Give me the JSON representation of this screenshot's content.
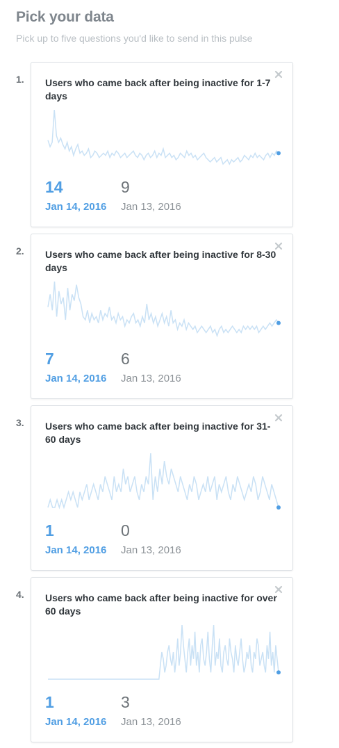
{
  "header": {
    "title": "Pick your data",
    "subtitle": "Pick up to five questions you'd like to send in this pulse"
  },
  "colors": {
    "accent": "#509ee3",
    "sparkline": "#c9e1f5"
  },
  "cards": [
    {
      "number": "1.",
      "title": "Users who came back after being inactive for 1-7 days",
      "close_icon": "close-icon",
      "current_value": "14",
      "current_date": "Jan 14, 2016",
      "previous_value": "9",
      "previous_date": "Jan 13, 2016",
      "trend": [
        14,
        11,
        13,
        28,
        16,
        13,
        15,
        12,
        10,
        13,
        9,
        11,
        7,
        10,
        12,
        8,
        9,
        7,
        8,
        10,
        6,
        7,
        9,
        8,
        6,
        7,
        8,
        7,
        9,
        6,
        8,
        7,
        9,
        8,
        6,
        7,
        8,
        6,
        7,
        8,
        9,
        7,
        6,
        8,
        7,
        5,
        7,
        8,
        6,
        7,
        9,
        6,
        8,
        7,
        10,
        6,
        7,
        8,
        6,
        7,
        5,
        6,
        8,
        7,
        6,
        9,
        7,
        8,
        6,
        7,
        5,
        6,
        7,
        8,
        6,
        5,
        4,
        5,
        6,
        4,
        5,
        6,
        3,
        4,
        5,
        3,
        5,
        4,
        5,
        6,
        4,
        5,
        7,
        6,
        5,
        7,
        6,
        8,
        6,
        7,
        6,
        5,
        7,
        8,
        6,
        8,
        7,
        9,
        8
      ]
    },
    {
      "number": "2.",
      "title": "Users who came back after being inactive for 8-30 days",
      "close_icon": "close-icon",
      "current_value": "7",
      "current_date": "Jan 14, 2016",
      "previous_value": "6",
      "previous_date": "Jan 13, 2016",
      "trend": [
        10,
        14,
        9,
        18,
        7,
        15,
        11,
        13,
        6,
        16,
        9,
        14,
        12,
        17,
        13,
        11,
        7,
        6,
        9,
        5,
        8,
        6,
        7,
        5,
        9,
        6,
        8,
        7,
        10,
        6,
        7,
        5,
        8,
        6,
        7,
        4,
        6,
        5,
        7,
        8,
        5,
        6,
        4,
        7,
        5,
        11,
        6,
        8,
        5,
        7,
        4,
        6,
        8,
        5,
        7,
        4,
        9,
        5,
        6,
        3,
        5,
        4,
        6,
        3,
        5,
        4,
        3,
        4,
        2,
        3,
        4,
        3,
        2,
        3,
        4,
        2,
        3,
        1,
        3,
        4,
        2,
        3,
        2,
        3,
        4,
        3,
        2,
        3,
        2,
        4,
        3,
        4,
        3,
        4,
        3,
        4,
        2,
        3,
        4,
        3,
        4,
        5,
        4,
        5,
        6,
        5
      ]
    },
    {
      "number": "3.",
      "title": "Users who came back after being inactive for 31-60 days",
      "close_icon": "close-icon",
      "current_value": "1",
      "current_date": "Jan 14, 2016",
      "previous_value": "0",
      "previous_date": "Jan 13, 2016",
      "trend": [
        1,
        2,
        1,
        1,
        2,
        1,
        2,
        1,
        2,
        3,
        2,
        3,
        2,
        1,
        3,
        2,
        3,
        4,
        2,
        3,
        4,
        3,
        2,
        4,
        3,
        5,
        4,
        3,
        2,
        5,
        3,
        4,
        3,
        6,
        4,
        5,
        3,
        4,
        5,
        3,
        2,
        4,
        3,
        5,
        4,
        8,
        2,
        5,
        3,
        6,
        4,
        7,
        5,
        4,
        6,
        5,
        4,
        3,
        5,
        4,
        3,
        2,
        4,
        3,
        5,
        4,
        2,
        3,
        4,
        3,
        5,
        3,
        4,
        5,
        2,
        4,
        3,
        4,
        5,
        3,
        2,
        4,
        3,
        5,
        4,
        3,
        2,
        3,
        4,
        3,
        5,
        4,
        2,
        3,
        5,
        4,
        3,
        2,
        4,
        3,
        2,
        1
      ]
    },
    {
      "number": "4.",
      "title": "Users who came back after being inactive for over 60 days",
      "close_icon": "close-icon",
      "current_value": "1",
      "current_date": "Jan 14, 2016",
      "previous_value": "3",
      "previous_date": "Jan 13, 2016",
      "trend": [
        0,
        0,
        0,
        0,
        0,
        0,
        0,
        0,
        0,
        0,
        0,
        0,
        0,
        0,
        0,
        0,
        0,
        0,
        0,
        0,
        0,
        0,
        0,
        0,
        0,
        0,
        0,
        0,
        0,
        0,
        0,
        0,
        0,
        0,
        0,
        0,
        0,
        0,
        0,
        0,
        0,
        0,
        0,
        0,
        0,
        0,
        0,
        0,
        0,
        0,
        0,
        0,
        0,
        0,
        0,
        0,
        0,
        0,
        0,
        0,
        0,
        0,
        0,
        0,
        0,
        0,
        0,
        0,
        0,
        0,
        0,
        0,
        0,
        0,
        0,
        0,
        0,
        0,
        2,
        4,
        3,
        1,
        2,
        4,
        5,
        3,
        2,
        4,
        1,
        3,
        6,
        2,
        4,
        8,
        5,
        3,
        1,
        4,
        6,
        2,
        5,
        3,
        7,
        2,
        4,
        1,
        5,
        6,
        3,
        2,
        4,
        7,
        3,
        1,
        5,
        8,
        2,
        4,
        3,
        6,
        2,
        1,
        4,
        5,
        3,
        2,
        6,
        4,
        3,
        1,
        5,
        3,
        2,
        4,
        6,
        3,
        1,
        2,
        4,
        3,
        5,
        2,
        1,
        4,
        3,
        6,
        5,
        2,
        3,
        4,
        2,
        1,
        5,
        3,
        7,
        2,
        4,
        1,
        5,
        3,
        1
      ]
    }
  ]
}
